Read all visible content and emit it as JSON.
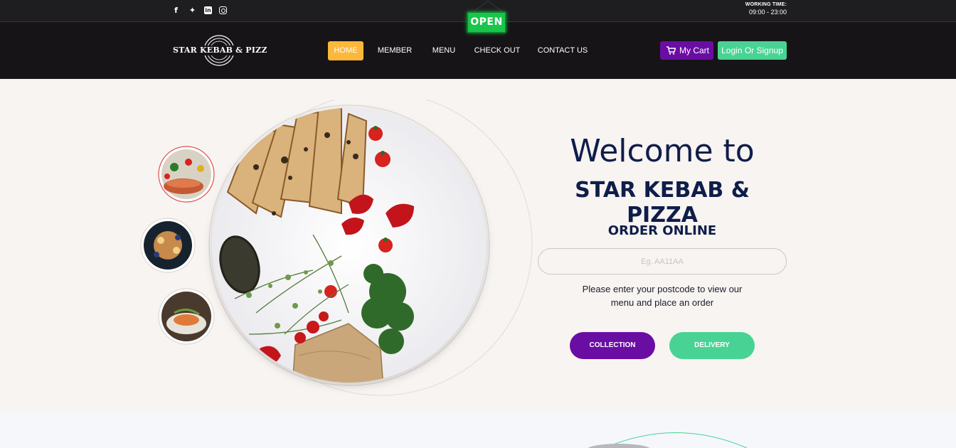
{
  "topbar": {
    "social": [
      {
        "icon": "facebook-icon",
        "glyph": "f"
      },
      {
        "icon": "twitter-icon",
        "glyph": "✦"
      },
      {
        "icon": "linkedin-icon",
        "glyph": "in"
      },
      {
        "icon": "instagram-icon",
        "glyph": ""
      }
    ],
    "working_label": "WORKING TIME:",
    "working_hours": "09:00 - 23:00"
  },
  "open_sign": "OPEN",
  "nav": {
    "logo_text": "STAR KEBAB & PIZZ",
    "items": [
      "HOME",
      "MEMBER",
      "MENU",
      "CHECK OUT",
      "CONTACT US"
    ],
    "active": "HOME",
    "cart_label": "My Cart",
    "login_label": "Login Or Signup"
  },
  "hero": {
    "welcome": "Welcome to",
    "brand": "STAR KEBAB & PIZZA",
    "order_title": "ORDER ONLINE",
    "postcode_placeholder": "Eg. AA11AA",
    "hint": "Please enter your postcode to view our menu and place an order",
    "collection_label": "COLLECTION",
    "delivery_label": "DELIVERY"
  },
  "colors": {
    "accent_yellow": "#fcb83a",
    "purple": "#6a0da3",
    "green": "#48d394",
    "navy": "#0f1d4a",
    "dark": "#161417"
  }
}
